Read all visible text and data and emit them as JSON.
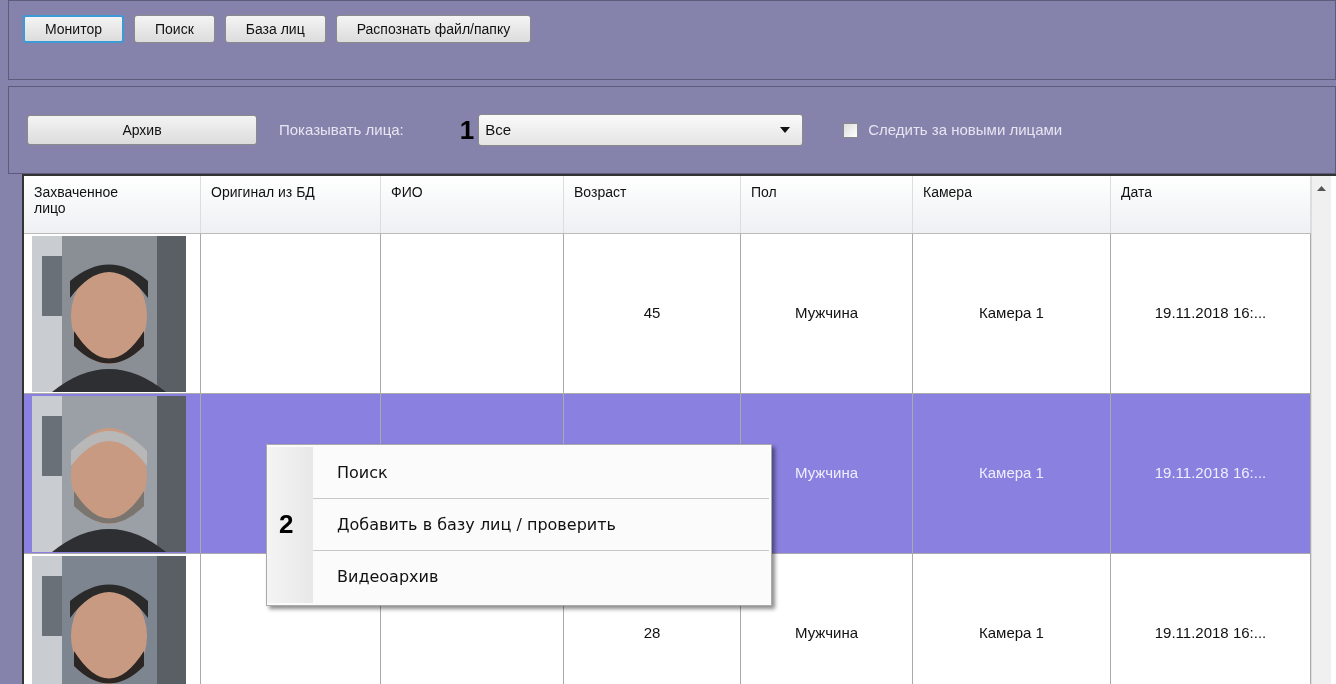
{
  "tabs": [
    {
      "label": "Монитор",
      "selected": true
    },
    {
      "label": "Поиск",
      "selected": false
    },
    {
      "label": "База лиц",
      "selected": false
    },
    {
      "label": "Распознать файл/папку",
      "selected": false
    }
  ],
  "toolbar": {
    "archive_button": "Архив",
    "filter_label": "Показывать лица:",
    "filter_marker": "1",
    "filter_value": "Все",
    "follow_checkbox": {
      "label": "Следить за новыми лицами",
      "checked": false
    }
  },
  "table": {
    "columns": [
      "Захваченное лицо",
      "Оригинал из БД",
      "ФИО",
      "Возраст",
      "Пол",
      "Камера",
      "Дата"
    ],
    "rows": [
      {
        "selected": false,
        "age": "45",
        "gender": "Мужчина",
        "camera": "Камера 1",
        "date": "19.11.2018 16:..."
      },
      {
        "selected": true,
        "gender": "Мужчина",
        "camera": "Камера 1",
        "date": "19.11.2018 16:..."
      },
      {
        "selected": false,
        "age": "28",
        "gender": "Мужчина",
        "camera": "Камера 1",
        "date": "19.11.2018 16:..."
      }
    ]
  },
  "context_menu": {
    "items": [
      {
        "label": "Поиск"
      },
      {
        "label": "Добавить в базу лиц / проверить",
        "marker": "2"
      },
      {
        "label": "Видеоархив"
      }
    ]
  }
}
